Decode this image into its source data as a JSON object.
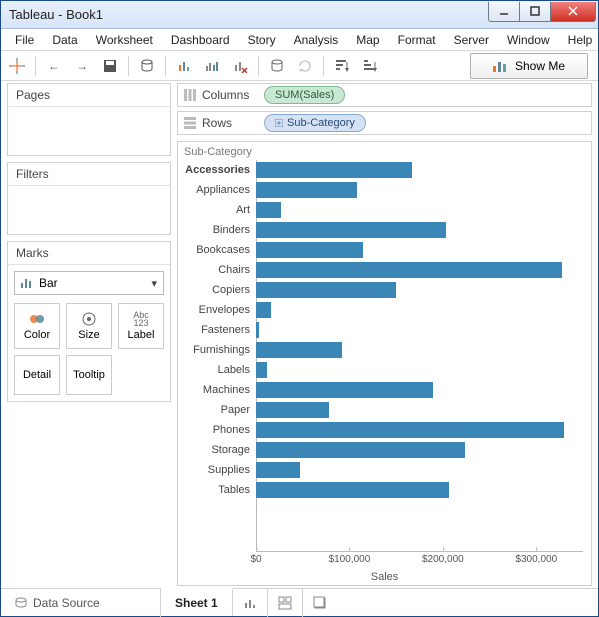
{
  "window": {
    "title": "Tableau - Book1"
  },
  "menubar": [
    "File",
    "Data",
    "Worksheet",
    "Dashboard",
    "Story",
    "Analysis",
    "Map",
    "Format",
    "Server",
    "Window",
    "Help"
  ],
  "toolbar": {
    "showme_label": "Show Me"
  },
  "side": {
    "pages_title": "Pages",
    "filters_title": "Filters",
    "marks_title": "Marks",
    "mark_type": "Bar",
    "btns": {
      "color": "Color",
      "size": "Size",
      "label": "Label",
      "detail": "Detail",
      "tooltip": "Tooltip"
    }
  },
  "shelves": {
    "columns_label": "Columns",
    "rows_label": "Rows",
    "columns_pill": "SUM(Sales)",
    "rows_pill": "Sub-Category"
  },
  "viz": {
    "header": "Sub-Category",
    "xlabel": "Sales"
  },
  "bottom": {
    "data_source": "Data Source",
    "sheet": "Sheet 1"
  },
  "chart_data": {
    "type": "bar",
    "orientation": "horizontal",
    "xlabel": "Sales",
    "ylabel": "Sub-Category",
    "xlim": [
      0,
      350000
    ],
    "xticks": [
      0,
      100000,
      200000,
      300000
    ],
    "xtick_labels": [
      "$0",
      "$100,000",
      "$200,000",
      "$300,000"
    ],
    "categories": [
      "Accessories",
      "Appliances",
      "Art",
      "Binders",
      "Bookcases",
      "Chairs",
      "Copiers",
      "Envelopes",
      "Fasteners",
      "Furnishings",
      "Labels",
      "Machines",
      "Paper",
      "Phones",
      "Storage",
      "Supplies",
      "Tables"
    ],
    "values": [
      167000,
      108000,
      27000,
      203000,
      115000,
      328000,
      150000,
      16000,
      3000,
      92000,
      12000,
      189000,
      78000,
      330000,
      224000,
      47000,
      207000
    ]
  }
}
